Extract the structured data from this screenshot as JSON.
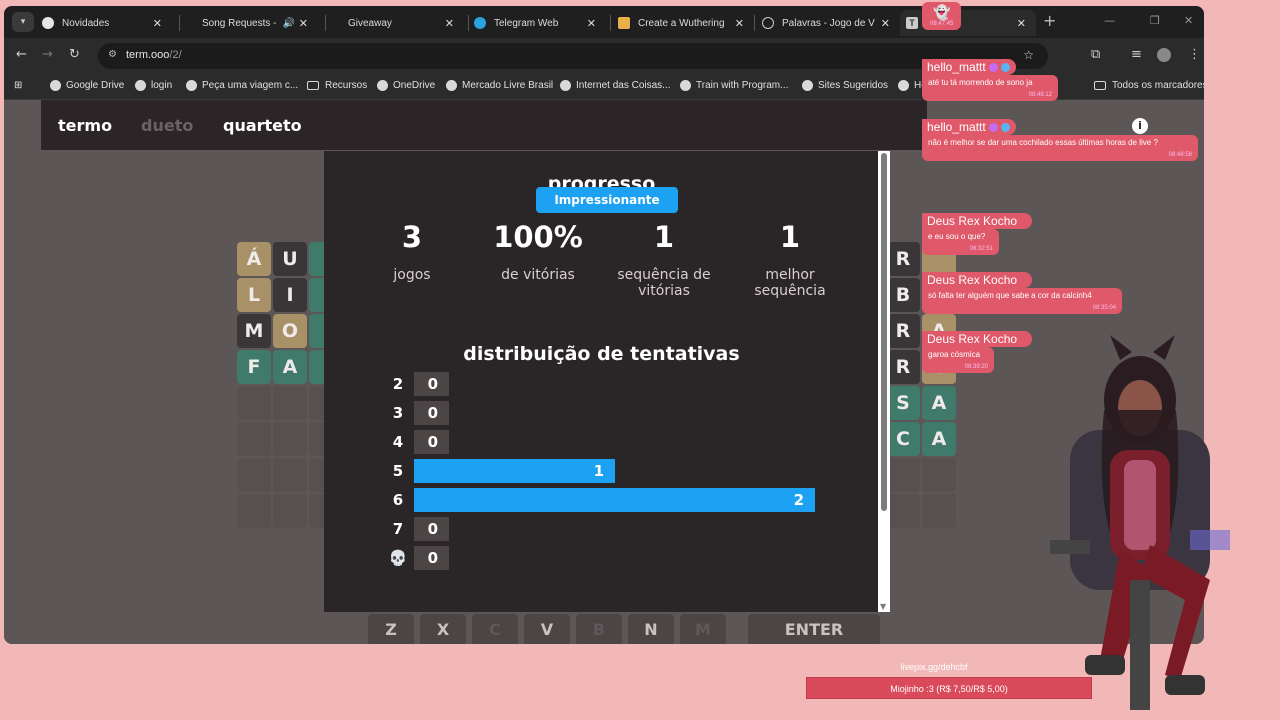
{
  "browser": {
    "tabs": [
      {
        "title": "Novidades",
        "icon": "chrome-icon"
      },
      {
        "title": "Song Requests -",
        "icon": "speaker-icon"
      },
      {
        "title": "Giveaway",
        "icon": ""
      },
      {
        "title": "Telegram Web",
        "icon": "telegram-icon"
      },
      {
        "title": "Create a Wuthering",
        "icon": "doc-icon"
      },
      {
        "title": "Palavras - Jogo de V",
        "icon": "globe-icon"
      },
      {
        "title": "T",
        "icon": "termo-icon"
      }
    ],
    "url_host": "term.ooo",
    "url_path": "/2/",
    "bookmarks": [
      {
        "label": "Google Drive"
      },
      {
        "label": "login"
      },
      {
        "label": "Peça uma viagem c..."
      },
      {
        "label": "Recursos"
      },
      {
        "label": "OneDrive"
      },
      {
        "label": "Mercado Livre Brasil"
      },
      {
        "label": "Internet das Coisas..."
      },
      {
        "label": "Train with Program..."
      },
      {
        "label": "Sites Sugeridos"
      },
      {
        "label": "Ho"
      },
      {
        "label": "Todos os marcadores"
      }
    ]
  },
  "game": {
    "modes": [
      "termo",
      "dueto",
      "quarteto"
    ],
    "left_board": [
      [
        "Á",
        "U",
        ""
      ],
      [
        "L",
        "I",
        ""
      ],
      [
        "M",
        "O",
        ""
      ],
      [
        "F",
        "A",
        ""
      ]
    ],
    "right_board": [
      [
        "R",
        ""
      ],
      [
        "B",
        "F"
      ],
      [
        "R",
        "A"
      ],
      [
        "R",
        "O"
      ],
      [
        "S",
        "S",
        "A"
      ],
      [
        "S",
        "C",
        "A"
      ]
    ],
    "keys": [
      "Z",
      "X",
      "C",
      "V",
      "B",
      "N",
      "M",
      "ENTER"
    ]
  },
  "modal": {
    "title": "progresso",
    "toast": "Impressionante",
    "stats": [
      {
        "value": "3",
        "label": "jogos"
      },
      {
        "value": "100%",
        "label": "de vitórias"
      },
      {
        "value": "1",
        "label": "sequência de vitórias"
      },
      {
        "value": "1",
        "label": "melhor sequência"
      }
    ],
    "distribution_title": "distribuição de tentativas",
    "chart_data": {
      "type": "bar",
      "title": "distribuição de tentativas",
      "categories": [
        "2",
        "3",
        "4",
        "5",
        "6",
        "7",
        "💀"
      ],
      "values": [
        0,
        0,
        0,
        1,
        2,
        0,
        0
      ],
      "value_labels": [
        "0",
        "0",
        "0",
        "1",
        "2",
        "0",
        "0"
      ],
      "highlight_color": "#1da1f2"
    }
  },
  "chat": [
    {
      "time": "08:47:45",
      "name": "",
      "text": ""
    },
    {
      "name": "hello_mattt",
      "text": "até tu tá morrendo de sono ja",
      "time": "08:48:12"
    },
    {
      "name": "hello_mattt",
      "text": "não é melhor se dar uma cochilado essas últimas horas de live ?",
      "time": "08:48:58"
    },
    {
      "name": "Deus Rex Kocho",
      "text": "e eu sou o que?",
      "time": "08:32:51"
    },
    {
      "name": "Deus Rex Kocho",
      "text": "só falta ter alguém que sabe a cor da calcinh4",
      "time": "08:35:04"
    },
    {
      "name": "Deus Rex Kocho",
      "text": "garoa cósmica",
      "time": "08:39:20"
    }
  ],
  "donation": {
    "url": "livepix.gg/dehcbf",
    "text": "Miojinho :3 (R$ 7,50/R$ 5,00)"
  },
  "colors": {
    "accent": "#1da1f2",
    "chat": "#e0596a",
    "stream_bg": "#f2b8b8"
  }
}
